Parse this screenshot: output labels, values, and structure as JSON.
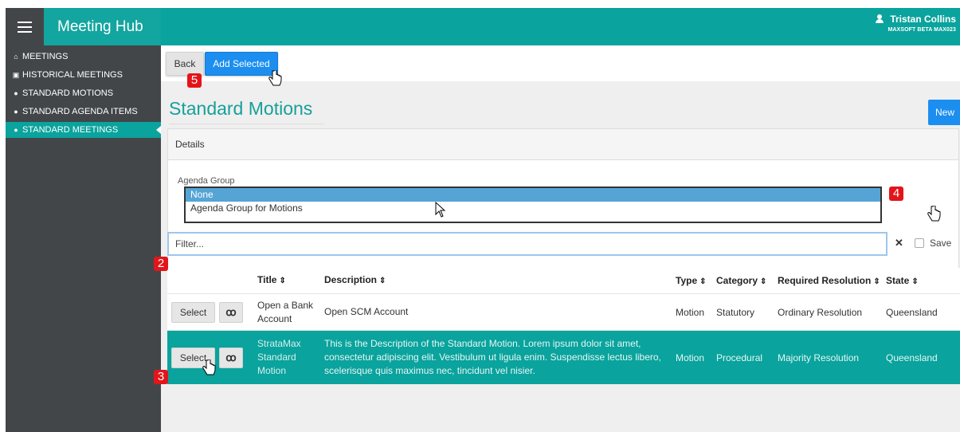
{
  "header": {
    "app_title": "Meeting Hub",
    "user_name": "Tristan Collins",
    "user_sub": "MAXSOFT BETA MAX023"
  },
  "sidebar": {
    "items": [
      {
        "label": "MEETINGS",
        "icon": "home-icon"
      },
      {
        "label": "HISTORICAL MEETINGS",
        "icon": "calendar-icon"
      },
      {
        "label": "STANDARD MOTIONS",
        "icon": "dashboard-icon"
      },
      {
        "label": "STANDARD AGENDA ITEMS",
        "icon": "dashboard-icon"
      },
      {
        "label": "STANDARD MEETINGS",
        "icon": "dashboard-icon",
        "active": true
      }
    ]
  },
  "toolbar": {
    "back_label": "Back",
    "add_selected_label": "Add Selected"
  },
  "page": {
    "title": "Standard Motions"
  },
  "details": {
    "panel_title": "Details",
    "agenda_group_label": "Agenda Group",
    "agenda_group_options": [
      "None",
      "Agenda Group for Motions"
    ],
    "agenda_group_selected": "None",
    "new_label": "New"
  },
  "filter": {
    "placeholder": "Filter...",
    "clear_symbol": "✕",
    "save_label": "Save",
    "save_checked": false
  },
  "table": {
    "headers": [
      "Title",
      "Description",
      "Type",
      "Category",
      "Required Resolution",
      "State"
    ],
    "select_label": "Select",
    "view_icon": "glasses-icon",
    "rows": [
      {
        "title": "Open a Bank Account",
        "description": "Open SCM Account",
        "type": "Motion",
        "category": "Statutory",
        "required_resolution": "Ordinary Resolution",
        "state": "Queensland"
      },
      {
        "title": "StrataMax Standard Motion",
        "description": "This is the Description of the Standard Motion. Lorem ipsum dolor sit amet, consectetur adipiscing elit. Vestibulum ut ligula enim. Suspendisse lectus libero, scelerisque quis maximus nec, tincidunt vel nisier.",
        "type": "Motion",
        "category": "Procedural",
        "required_resolution": "Majority Resolution",
        "state": "Queensland",
        "highlighted": true
      }
    ]
  },
  "annotations": [
    "5",
    "4",
    "2",
    "3"
  ],
  "colors": {
    "teal": "#0aa39d",
    "dark": "#434649",
    "primary": "#1b8ef0",
    "badge": "#e3151a"
  }
}
